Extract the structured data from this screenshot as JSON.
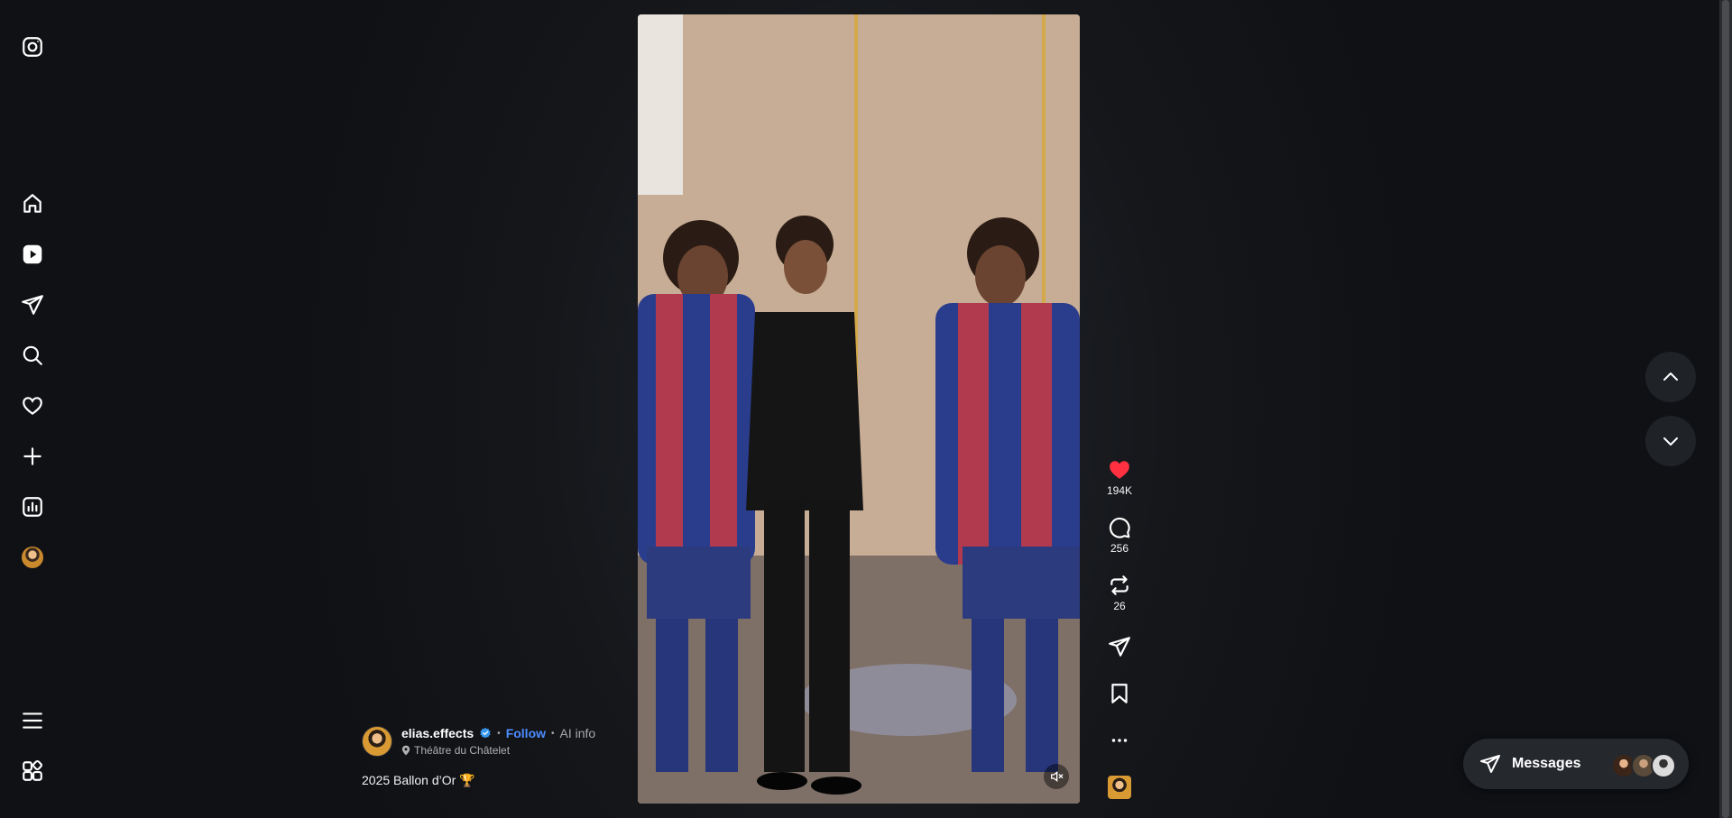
{
  "sidebar": {
    "items": [
      {
        "name": "instagram-logo",
        "icon": "instagram-icon"
      },
      {
        "name": "home",
        "icon": "home-icon"
      },
      {
        "name": "reels",
        "icon": "reels-icon"
      },
      {
        "name": "messages",
        "icon": "send-icon"
      },
      {
        "name": "search",
        "icon": "search-icon"
      },
      {
        "name": "notifications",
        "icon": "heart-icon"
      },
      {
        "name": "create",
        "icon": "plus-icon"
      },
      {
        "name": "dashboard",
        "icon": "chart-icon"
      },
      {
        "name": "profile",
        "icon": "avatar"
      },
      {
        "name": "more",
        "icon": "menu-icon"
      },
      {
        "name": "also-from-meta",
        "icon": "apps-icon"
      }
    ]
  },
  "post": {
    "username": "elias.effects",
    "follow_label": "Follow",
    "ai_info_label": "AI info",
    "separator": "•",
    "location": "Théâtre du Châtelet",
    "caption": "2025 Ballon d’Or 🏆"
  },
  "actions": {
    "likes": "194K",
    "comments": "256",
    "reposts": "26"
  },
  "messages_bar": {
    "label": "Messages"
  },
  "colors": {
    "like": "#ff3040",
    "link": "#4c8dff",
    "background": "#0f1115"
  }
}
